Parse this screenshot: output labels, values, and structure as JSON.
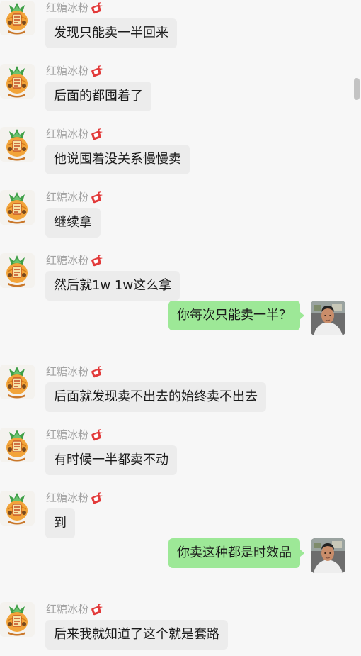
{
  "contact": {
    "name": "红糖冰粉"
  },
  "messages": [
    {
      "dir": "in",
      "text": "发现只能卖一半回来"
    },
    {
      "dir": "in",
      "text": "后面的都囤着了"
    },
    {
      "dir": "in",
      "text": "他说囤着没关系慢慢卖"
    },
    {
      "dir": "in",
      "text": "继续拿"
    },
    {
      "dir": "in",
      "text": "然后就1w 1w这么拿"
    },
    {
      "dir": "out",
      "text": "你每次只能卖一半？"
    },
    {
      "dir": "in",
      "text": "后面就发现卖不出去的始终卖不出去"
    },
    {
      "dir": "in",
      "text": "有时候一半都卖不动"
    },
    {
      "dir": "in",
      "text": "到"
    },
    {
      "dir": "out",
      "text": "你卖这种都是时效品"
    },
    {
      "dir": "in",
      "text": "后来我就知道了这个就是套路"
    }
  ],
  "colors": {
    "background": "#f7f7f7",
    "incoming_bubble": "#ececec",
    "outgoing_bubble": "#9de897",
    "sender_name": "#a2a2a2"
  },
  "icons": {
    "contact_avatar": "cartoon-pineapple-avatar-icon",
    "own_avatar": "user-photo-avatar",
    "sender_badge": "gift-badge-icon"
  }
}
